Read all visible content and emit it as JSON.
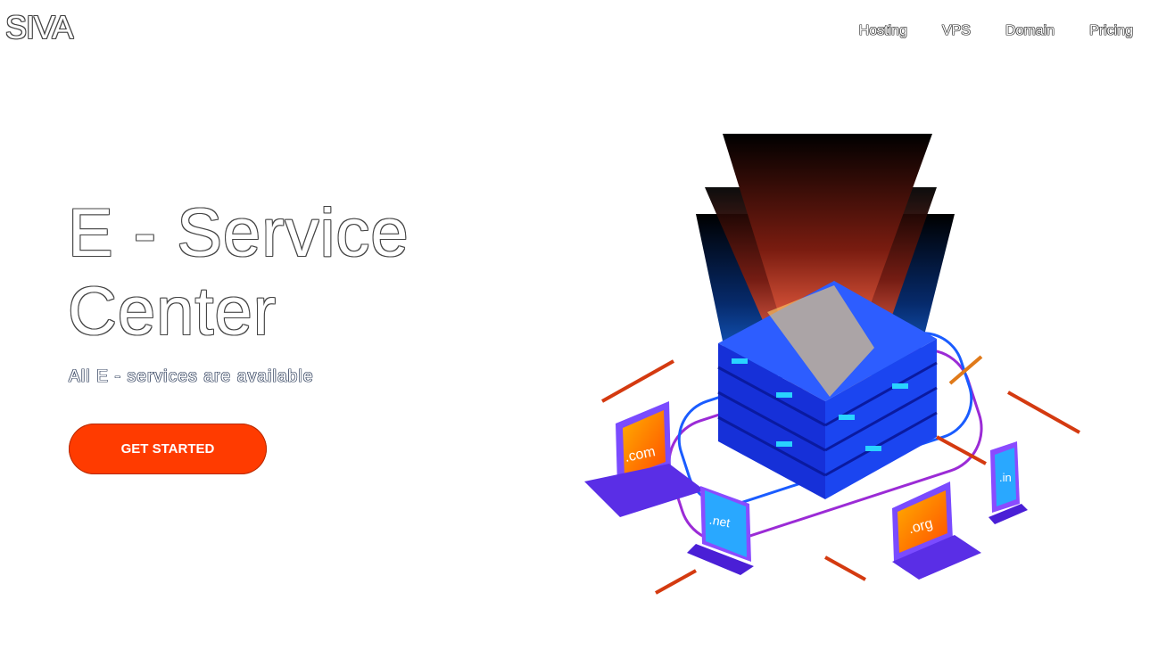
{
  "header": {
    "logo": "SIVA",
    "nav": [
      "Hosting",
      "VPS",
      "Domain",
      "Pricing"
    ]
  },
  "hero": {
    "title_line1": "E - Service",
    "title_line2": "Center",
    "subtitle": "All E - services are available",
    "cta_label": "GET STARTED"
  },
  "illustration": {
    "tld_labels": [
      ".com",
      ".net",
      ".org",
      ".in"
    ]
  },
  "colors": {
    "accent": "#ff3b00",
    "server_blue": "#1f3cff",
    "laptop_purple": "#6b3bff",
    "screen_orange": "#ff8a00"
  }
}
